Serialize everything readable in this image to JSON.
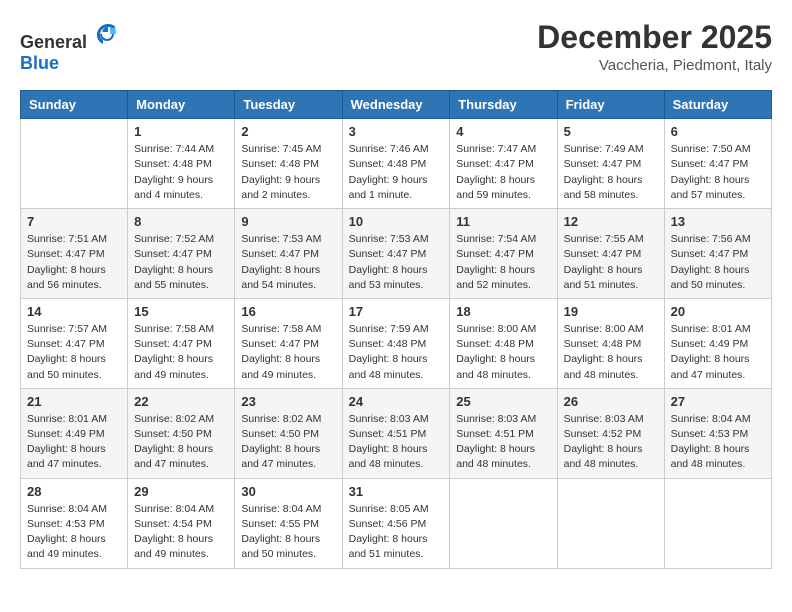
{
  "logo": {
    "general": "General",
    "blue": "Blue"
  },
  "title": {
    "month": "December 2025",
    "location": "Vaccheria, Piedmont, Italy"
  },
  "headers": [
    "Sunday",
    "Monday",
    "Tuesday",
    "Wednesday",
    "Thursday",
    "Friday",
    "Saturday"
  ],
  "weeks": [
    [
      {
        "day": "",
        "info": ""
      },
      {
        "day": "1",
        "info": "Sunrise: 7:44 AM\nSunset: 4:48 PM\nDaylight: 9 hours\nand 4 minutes."
      },
      {
        "day": "2",
        "info": "Sunrise: 7:45 AM\nSunset: 4:48 PM\nDaylight: 9 hours\nand 2 minutes."
      },
      {
        "day": "3",
        "info": "Sunrise: 7:46 AM\nSunset: 4:48 PM\nDaylight: 9 hours\nand 1 minute."
      },
      {
        "day": "4",
        "info": "Sunrise: 7:47 AM\nSunset: 4:47 PM\nDaylight: 8 hours\nand 59 minutes."
      },
      {
        "day": "5",
        "info": "Sunrise: 7:49 AM\nSunset: 4:47 PM\nDaylight: 8 hours\nand 58 minutes."
      },
      {
        "day": "6",
        "info": "Sunrise: 7:50 AM\nSunset: 4:47 PM\nDaylight: 8 hours\nand 57 minutes."
      }
    ],
    [
      {
        "day": "7",
        "info": "Sunrise: 7:51 AM\nSunset: 4:47 PM\nDaylight: 8 hours\nand 56 minutes."
      },
      {
        "day": "8",
        "info": "Sunrise: 7:52 AM\nSunset: 4:47 PM\nDaylight: 8 hours\nand 55 minutes."
      },
      {
        "day": "9",
        "info": "Sunrise: 7:53 AM\nSunset: 4:47 PM\nDaylight: 8 hours\nand 54 minutes."
      },
      {
        "day": "10",
        "info": "Sunrise: 7:53 AM\nSunset: 4:47 PM\nDaylight: 8 hours\nand 53 minutes."
      },
      {
        "day": "11",
        "info": "Sunrise: 7:54 AM\nSunset: 4:47 PM\nDaylight: 8 hours\nand 52 minutes."
      },
      {
        "day": "12",
        "info": "Sunrise: 7:55 AM\nSunset: 4:47 PM\nDaylight: 8 hours\nand 51 minutes."
      },
      {
        "day": "13",
        "info": "Sunrise: 7:56 AM\nSunset: 4:47 PM\nDaylight: 8 hours\nand 50 minutes."
      }
    ],
    [
      {
        "day": "14",
        "info": "Sunrise: 7:57 AM\nSunset: 4:47 PM\nDaylight: 8 hours\nand 50 minutes."
      },
      {
        "day": "15",
        "info": "Sunrise: 7:58 AM\nSunset: 4:47 PM\nDaylight: 8 hours\nand 49 minutes."
      },
      {
        "day": "16",
        "info": "Sunrise: 7:58 AM\nSunset: 4:47 PM\nDaylight: 8 hours\nand 49 minutes."
      },
      {
        "day": "17",
        "info": "Sunrise: 7:59 AM\nSunset: 4:48 PM\nDaylight: 8 hours\nand 48 minutes."
      },
      {
        "day": "18",
        "info": "Sunrise: 8:00 AM\nSunset: 4:48 PM\nDaylight: 8 hours\nand 48 minutes."
      },
      {
        "day": "19",
        "info": "Sunrise: 8:00 AM\nSunset: 4:48 PM\nDaylight: 8 hours\nand 48 minutes."
      },
      {
        "day": "20",
        "info": "Sunrise: 8:01 AM\nSunset: 4:49 PM\nDaylight: 8 hours\nand 47 minutes."
      }
    ],
    [
      {
        "day": "21",
        "info": "Sunrise: 8:01 AM\nSunset: 4:49 PM\nDaylight: 8 hours\nand 47 minutes."
      },
      {
        "day": "22",
        "info": "Sunrise: 8:02 AM\nSunset: 4:50 PM\nDaylight: 8 hours\nand 47 minutes."
      },
      {
        "day": "23",
        "info": "Sunrise: 8:02 AM\nSunset: 4:50 PM\nDaylight: 8 hours\nand 47 minutes."
      },
      {
        "day": "24",
        "info": "Sunrise: 8:03 AM\nSunset: 4:51 PM\nDaylight: 8 hours\nand 48 minutes."
      },
      {
        "day": "25",
        "info": "Sunrise: 8:03 AM\nSunset: 4:51 PM\nDaylight: 8 hours\nand 48 minutes."
      },
      {
        "day": "26",
        "info": "Sunrise: 8:03 AM\nSunset: 4:52 PM\nDaylight: 8 hours\nand 48 minutes."
      },
      {
        "day": "27",
        "info": "Sunrise: 8:04 AM\nSunset: 4:53 PM\nDaylight: 8 hours\nand 48 minutes."
      }
    ],
    [
      {
        "day": "28",
        "info": "Sunrise: 8:04 AM\nSunset: 4:53 PM\nDaylight: 8 hours\nand 49 minutes."
      },
      {
        "day": "29",
        "info": "Sunrise: 8:04 AM\nSunset: 4:54 PM\nDaylight: 8 hours\nand 49 minutes."
      },
      {
        "day": "30",
        "info": "Sunrise: 8:04 AM\nSunset: 4:55 PM\nDaylight: 8 hours\nand 50 minutes."
      },
      {
        "day": "31",
        "info": "Sunrise: 8:05 AM\nSunset: 4:56 PM\nDaylight: 8 hours\nand 51 minutes."
      },
      {
        "day": "",
        "info": ""
      },
      {
        "day": "",
        "info": ""
      },
      {
        "day": "",
        "info": ""
      }
    ]
  ]
}
